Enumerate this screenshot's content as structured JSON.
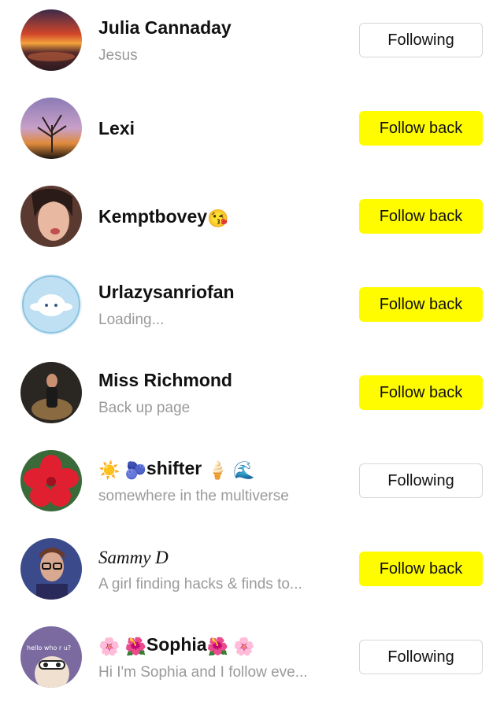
{
  "rows": [
    {
      "name": "Julia Cannaday",
      "subtitle": "Jesus",
      "button": "Following",
      "avatar_icon": "sunset-photo"
    },
    {
      "name": "Lexi",
      "subtitle": "",
      "button": "Follow back",
      "avatar_icon": "bare-tree-sunset-photo"
    },
    {
      "name": "Kemptbovey",
      "name_emoji": "😘",
      "subtitle": "",
      "button": "Follow back",
      "avatar_icon": "selfie-photo"
    },
    {
      "name": "Urlazysanriofan",
      "subtitle": "Loading...",
      "button": "Follow back",
      "avatar_icon": "cinnamoroll-badge"
    },
    {
      "name": "Miss Richmond",
      "subtitle": "Back up page",
      "button": "Follow back",
      "avatar_icon": "person-chair-photo"
    },
    {
      "name_prefix": "☀️ 🫐",
      "name": "shifter",
      "name_suffix": "🍦 🌊",
      "subtitle": "somewhere in the multiverse",
      "button": "Following",
      "avatar_icon": "red-hibiscus-photo"
    },
    {
      "name": "Sammy D",
      "subtitle": "A girl finding hacks & finds to...",
      "button": "Follow back",
      "avatar_icon": "glasses-selfie-photo"
    },
    {
      "name_prefix": "🌸 🌺",
      "name": "Sophia",
      "name_suffix": "🌺 🌸",
      "subtitle": "Hi I'm Sophia and I follow eve...",
      "button": "Following",
      "avatar_icon": "hello-who-r-u-photo",
      "avatar_text": "hello who r u?"
    }
  ],
  "colors": {
    "follow_back_bg": "#fffc00",
    "following_border": "#d6d6d6",
    "subtitle": "#9a9a9a"
  }
}
